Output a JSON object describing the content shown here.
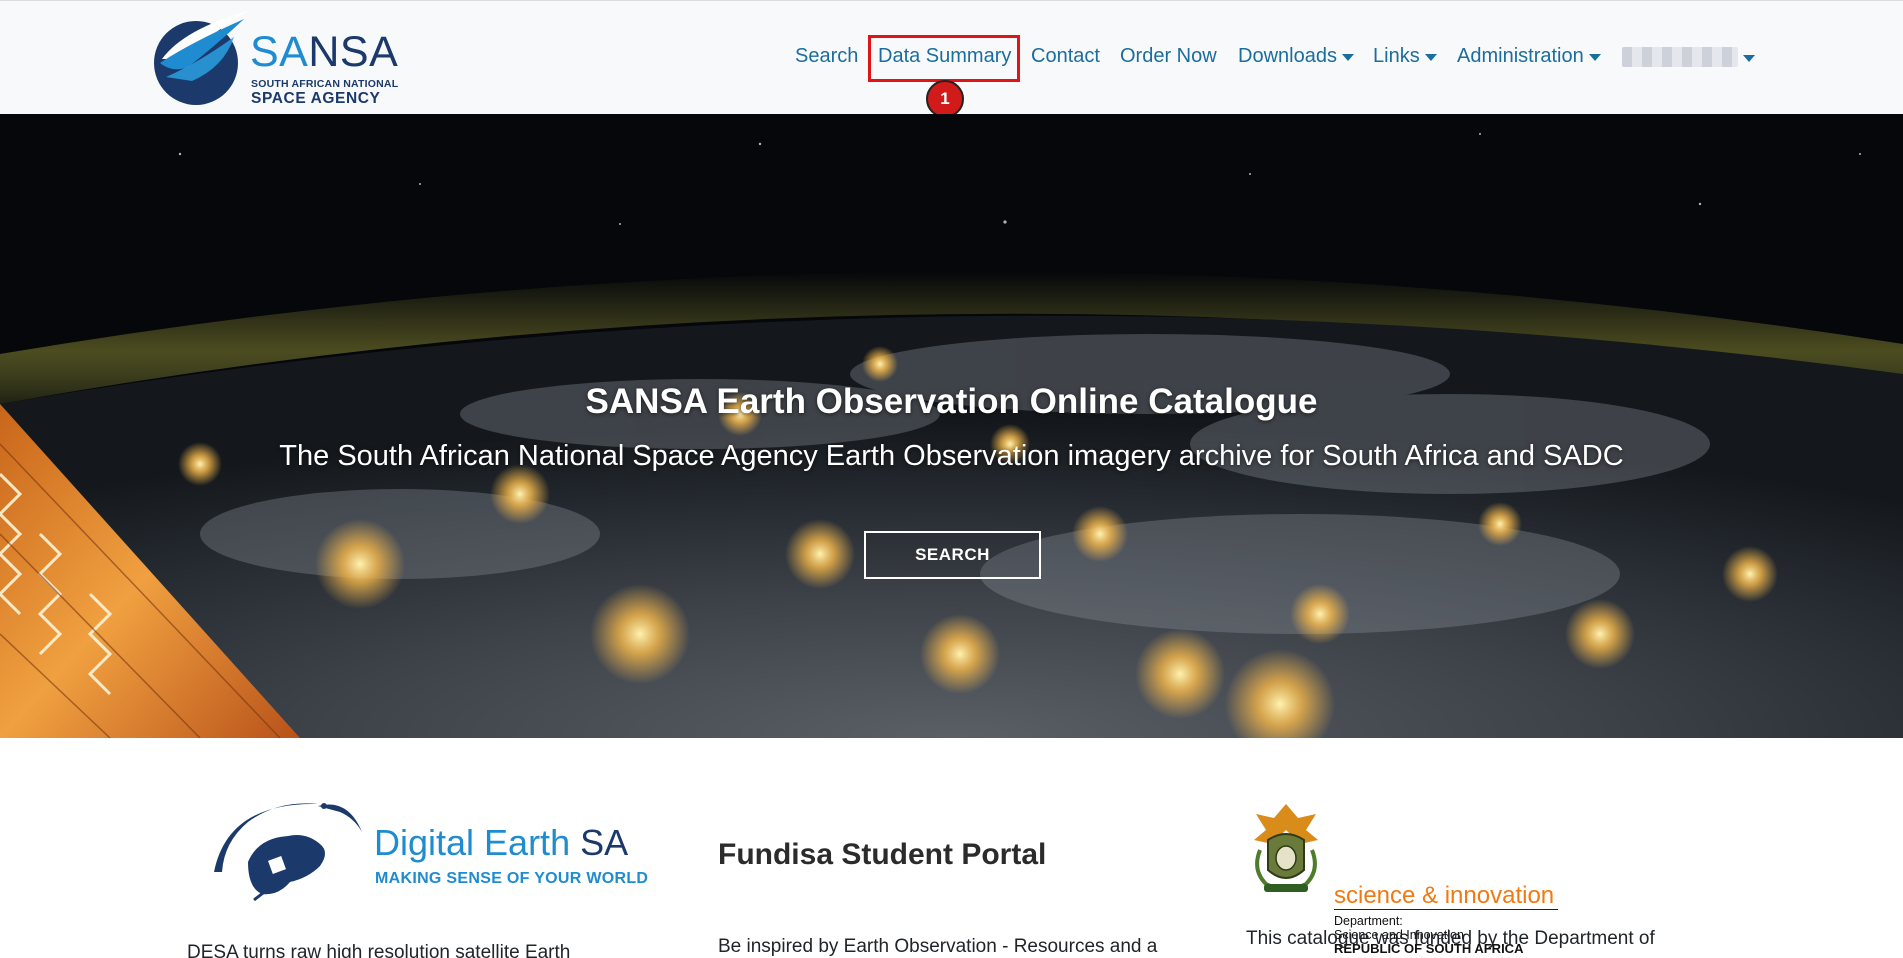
{
  "brand": {
    "name_part1": "SA",
    "name_part2": "NSA",
    "subtitle_line1": "SOUTH AFRICAN NATIONAL",
    "subtitle_line2": "SPACE AGENCY"
  },
  "nav": {
    "items": [
      {
        "label": "Search"
      },
      {
        "label": "Data Summary"
      },
      {
        "label": "Contact"
      },
      {
        "label": "Order Now"
      },
      {
        "label": "Downloads"
      },
      {
        "label": "Links"
      },
      {
        "label": "Administration"
      }
    ],
    "highlight_badge": "1"
  },
  "hero": {
    "title": "SANSA Earth Observation Online Catalogue",
    "subtitle": "The South African National Space Agency Earth Observation imagery archive for South Africa and SADC",
    "button_label": "SEARCH"
  },
  "cards": {
    "desa": {
      "logo_name_part1": "Digital Earth ",
      "logo_name_part2": "SA",
      "logo_tagline": "MAKING SENSE OF YOUR WORLD",
      "text": "DESA turns raw high resolution satellite Earth"
    },
    "fundisa": {
      "heading": "Fundisa Student Portal",
      "text": "Be inspired by Earth Observation - Resources and a"
    },
    "dsi": {
      "logo_title": "science & innovation",
      "logo_line1": "Department:",
      "logo_line2": "Science and Innovation",
      "logo_line3": "REPUBLIC OF SOUTH AFRICA",
      "text": "This catalogue was funded by the Department of"
    }
  },
  "colors": {
    "nav_link": "#1b6d9e",
    "brand_dark": "#1b3a6b",
    "brand_light": "#1f8bd1",
    "highlight": "#e01616",
    "dsi_orange": "#f07a12"
  }
}
